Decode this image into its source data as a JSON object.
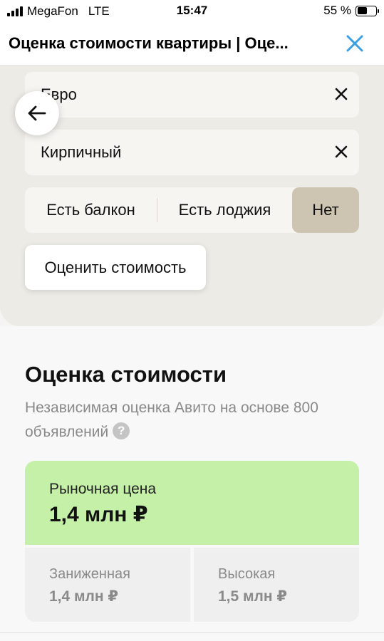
{
  "status_bar": {
    "carrier": "MegaFon",
    "network": "LTE",
    "time": "15:47",
    "battery_percent": "55 %",
    "battery_level": 0.55
  },
  "header": {
    "title": "Оценка стоимости квартиры | Оце...",
    "close_icon": "close-icon",
    "accent_color": "#3aa0e0"
  },
  "filters": {
    "renovation_value": "Евро",
    "building_type_value": "Кирпичный",
    "balcony_options": [
      "Есть балкон",
      "Есть лоджия",
      "Нет"
    ],
    "balcony_selected": "Нет",
    "estimate_button": "Оценить стоимость"
  },
  "estimate": {
    "title": "Оценка стоимости",
    "subtitle": "Независимая оценка Авито на основе 800 объявлений",
    "help_icon": "?",
    "market_label": "Рыночная цена",
    "market_price": "1,4 млн ₽",
    "low_label": "Заниженная",
    "low_price": "1,4 млн ₽",
    "high_label": "Высокая",
    "high_price": "1,5 млн ₽",
    "market_color": "#c4f0a8"
  }
}
